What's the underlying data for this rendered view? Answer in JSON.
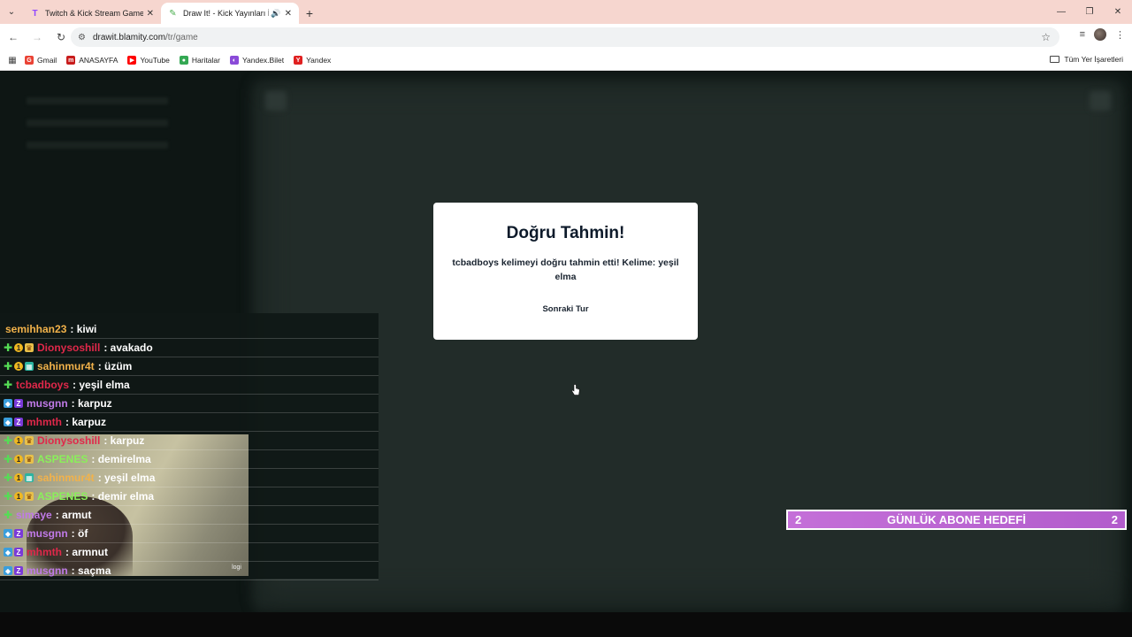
{
  "browser": {
    "tabs": [
      {
        "title": "Twitch & Kick Stream Games",
        "favicon": "T",
        "active": false
      },
      {
        "title": "Draw It! - Kick Yayınları İçin",
        "favicon": "pencil",
        "active": true
      }
    ],
    "url": {
      "host": "drawit.blamity.com",
      "path": "/tr/game"
    },
    "bookmarks": [
      {
        "label": "Gmail",
        "icon": "G",
        "color": "#ea4335"
      },
      {
        "label": "ANASAYFA",
        "icon": "m",
        "color": "#c81c1c"
      },
      {
        "label": "YouTube",
        "icon": "▶",
        "color": "#ff0000"
      },
      {
        "label": "Haritalar",
        "icon": "●",
        "color": "#34a853"
      },
      {
        "label": "Yandex.Bilet",
        "icon": "◐",
        "color": "#8a4ad8"
      },
      {
        "label": "Yandex",
        "icon": "Y",
        "color": "#e02020"
      }
    ],
    "all_bookmarks": "Tüm Yer İşaretleri"
  },
  "chat": {
    "messages": [
      {
        "badges": [],
        "user": "semihhan23",
        "color": "#f2b24a",
        "msg": ": kiwi"
      },
      {
        "badges": [
          "plus",
          "one",
          "crown"
        ],
        "user": "Dionysoshill",
        "color": "#e0284a",
        "msg": ": avakado"
      },
      {
        "badges": [
          "plus",
          "one",
          "grid"
        ],
        "user": "sahinmur4t",
        "color": "#f2b24a",
        "msg": ": üzüm"
      },
      {
        "badges": [
          "plus"
        ],
        "user": "tcbadboys",
        "color": "#e0284a",
        "msg": ": yeşil elma"
      },
      {
        "badges": [
          "cube",
          "z"
        ],
        "user": "musgnn",
        "color": "#c07ae8",
        "msg": ": karpuz"
      },
      {
        "badges": [
          "cube",
          "z"
        ],
        "user": "mhmth",
        "color": "#e0284a",
        "msg": ": karpuz"
      },
      {
        "badges": [
          "plus",
          "one",
          "crown"
        ],
        "user": "Dionysoshill",
        "color": "#e0284a",
        "msg": ": karpuz"
      },
      {
        "badges": [
          "plus",
          "one",
          "crown"
        ],
        "user": "ASPENES",
        "color": "#8af05a",
        "msg": ": demirelma"
      },
      {
        "badges": [
          "plus",
          "one",
          "grid"
        ],
        "user": "sahinmur4t",
        "color": "#f2b24a",
        "msg": ": yeşil elma"
      },
      {
        "badges": [
          "plus",
          "one",
          "crown"
        ],
        "user": "ASPENES",
        "color": "#8af05a",
        "msg": ": demir elma"
      },
      {
        "badges": [
          "plus"
        ],
        "user": "simaye",
        "color": "#c07ae8",
        "msg": ": armut"
      },
      {
        "badges": [
          "cube",
          "z"
        ],
        "user": "musgnn",
        "color": "#c07ae8",
        "msg": ": öf"
      },
      {
        "badges": [
          "cube",
          "z"
        ],
        "user": "mhmth",
        "color": "#e0284a",
        "msg": ": armnut"
      },
      {
        "badges": [
          "cube",
          "z"
        ],
        "user": "musgnn",
        "color": "#c07ae8",
        "msg": ": saçma"
      }
    ],
    "webcam_tag": "logi"
  },
  "modal": {
    "title": "Doğru Tahmin!",
    "message": "tcbadboys kelimeyi doğru tahmin etti! Kelime: yeşil elma",
    "next_button": "Sonraki Tur"
  },
  "goal": {
    "left": "2",
    "label": "GÜNLÜK ABONE HEDEFİ",
    "right": "2",
    "color": "#c46fd8"
  }
}
